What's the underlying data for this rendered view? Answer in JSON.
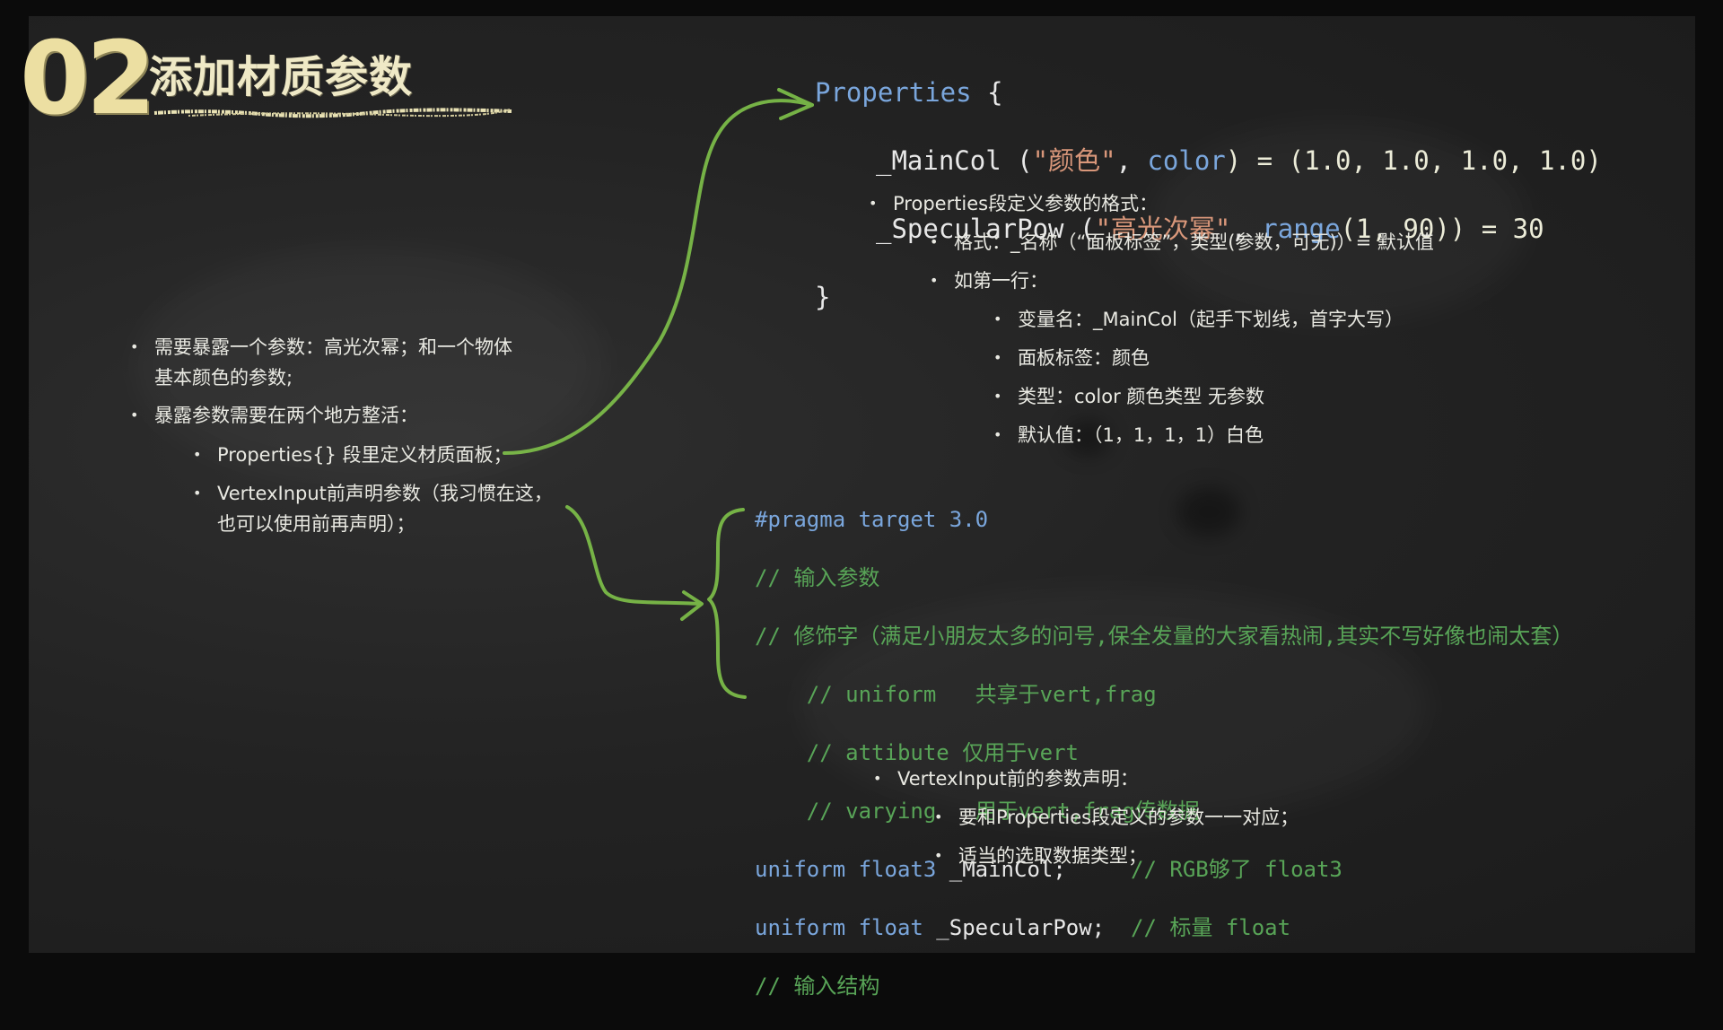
{
  "slide": {
    "number": "02",
    "title": "添加材质参数"
  },
  "left_notes": [
    "需要暴露一个参数：高光次幂；和一个物体",
    "基本颜色的参数;",
    "暴露参数需要在两个地方整活：",
    "Properties{} 段里定义材质面板；",
    "VertexInput前声明参数（我习惯在这，",
    "也可以使用前再声明）；"
  ],
  "properties_code": {
    "l1_kw": "Properties",
    "l1_brace": " {",
    "l2_name": "_MainCol",
    "l2_open": " (",
    "l2_label": "\"颜色\"",
    "l2_comma": ", ",
    "l2_type": "color",
    "l2_rest": ") = (1.0, 1.0, 1.0, 1.0)",
    "l3_name": "_SpecularPow",
    "l3_open": " (",
    "l3_label": "\"高光次幂\"",
    "l3_comma": ", ",
    "l3_type": "range",
    "l3_rest": "(1, 90)) = 30",
    "l4": "}"
  },
  "properties_notes": {
    "heading": "Properties段定义参数的格式：",
    "format": "格式：_名称（“面板标签”，类型(参数，可无)）= 默认值",
    "example": "如第一行：",
    "items": [
      "变量名：_MainCol（起手下划线，首字大写）",
      "面板标签：颜色",
      "类型：color 颜色类型 无参数",
      "默认值：（1，1，1，1）白色"
    ]
  },
  "shader_code": {
    "pragma": "#pragma target 3.0",
    "c1": "// 输入参数",
    "c2": "// 修饰字（满足小朋友太多的问号,保全发量的大家看热闹,其实不写好像也闹太套）",
    "c3": "    // uniform   共享于vert,frag",
    "c4": "    // attibute 仅用于vert",
    "c5": "    // varying   用于vert,frag传数据",
    "u1_kw": "uniform float3",
    "u1_id": " _MainCol;",
    "u1_cm": "     // RGB够了 float3",
    "u2_kw": "uniform float",
    "u2_id": " _SpecularPow;",
    "u2_cm": "  // 标量 float",
    "c6": "// 输入结构"
  },
  "vertex_notes": {
    "heading": "VertexInput前的参数声明：",
    "items": [
      "要和Properties段定义的参数一一对应；",
      "适当的选取数据类型；"
    ]
  },
  "colors": {
    "chalk_green": "#7fc24a",
    "title_yellow": "#ecdfa2",
    "keyword_blue": "#7aa6dc",
    "comment_green": "#58a457",
    "string_orange": "#d9977a"
  }
}
